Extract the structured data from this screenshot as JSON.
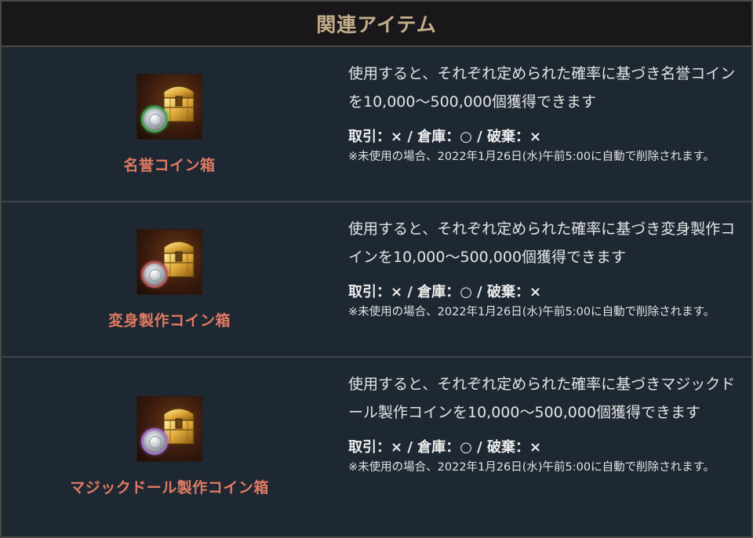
{
  "header": {
    "title": "関連アイテム"
  },
  "items": [
    {
      "name": "名誉コイン箱",
      "coin_color": "green",
      "description": "使用すると、それぞれ定められた確率に基づき名誉コインを10,000～500,000個獲得できます",
      "trade": "取引：× / 倉庫：○ / 破棄：×",
      "note": "※未使用の場合、2022年1月26日(水)午前5:00に自動で削除されます。"
    },
    {
      "name": "変身製作コイン箱",
      "coin_color": "red",
      "description": "使用すると、それぞれ定められた確率に基づき変身製作コインを10,000～500,000個獲得できます",
      "trade": "取引：× / 倉庫：○ / 破棄：×",
      "note": "※未使用の場合、2022年1月26日(水)午前5:00に自動で削除されます。"
    },
    {
      "name": "マジックドール製作コイン箱",
      "coin_color": "purple",
      "description": "使用すると、それぞれ定められた確率に基づきマジックドール製作コインを10,000～500,000個獲得できます",
      "trade": "取引：× / 倉庫：○ / 破棄：×",
      "note": "※未使用の場合、2022年1月26日(水)午前5:00に自動で削除されます。"
    }
  ],
  "colors": {
    "header_bg": "#19171a",
    "header_text": "#c4ae8a",
    "row_bg": "#1e2833",
    "item_name": "#e07a62"
  },
  "icons": {
    "item_icon": "treasure-chest-with-coin-icon"
  }
}
